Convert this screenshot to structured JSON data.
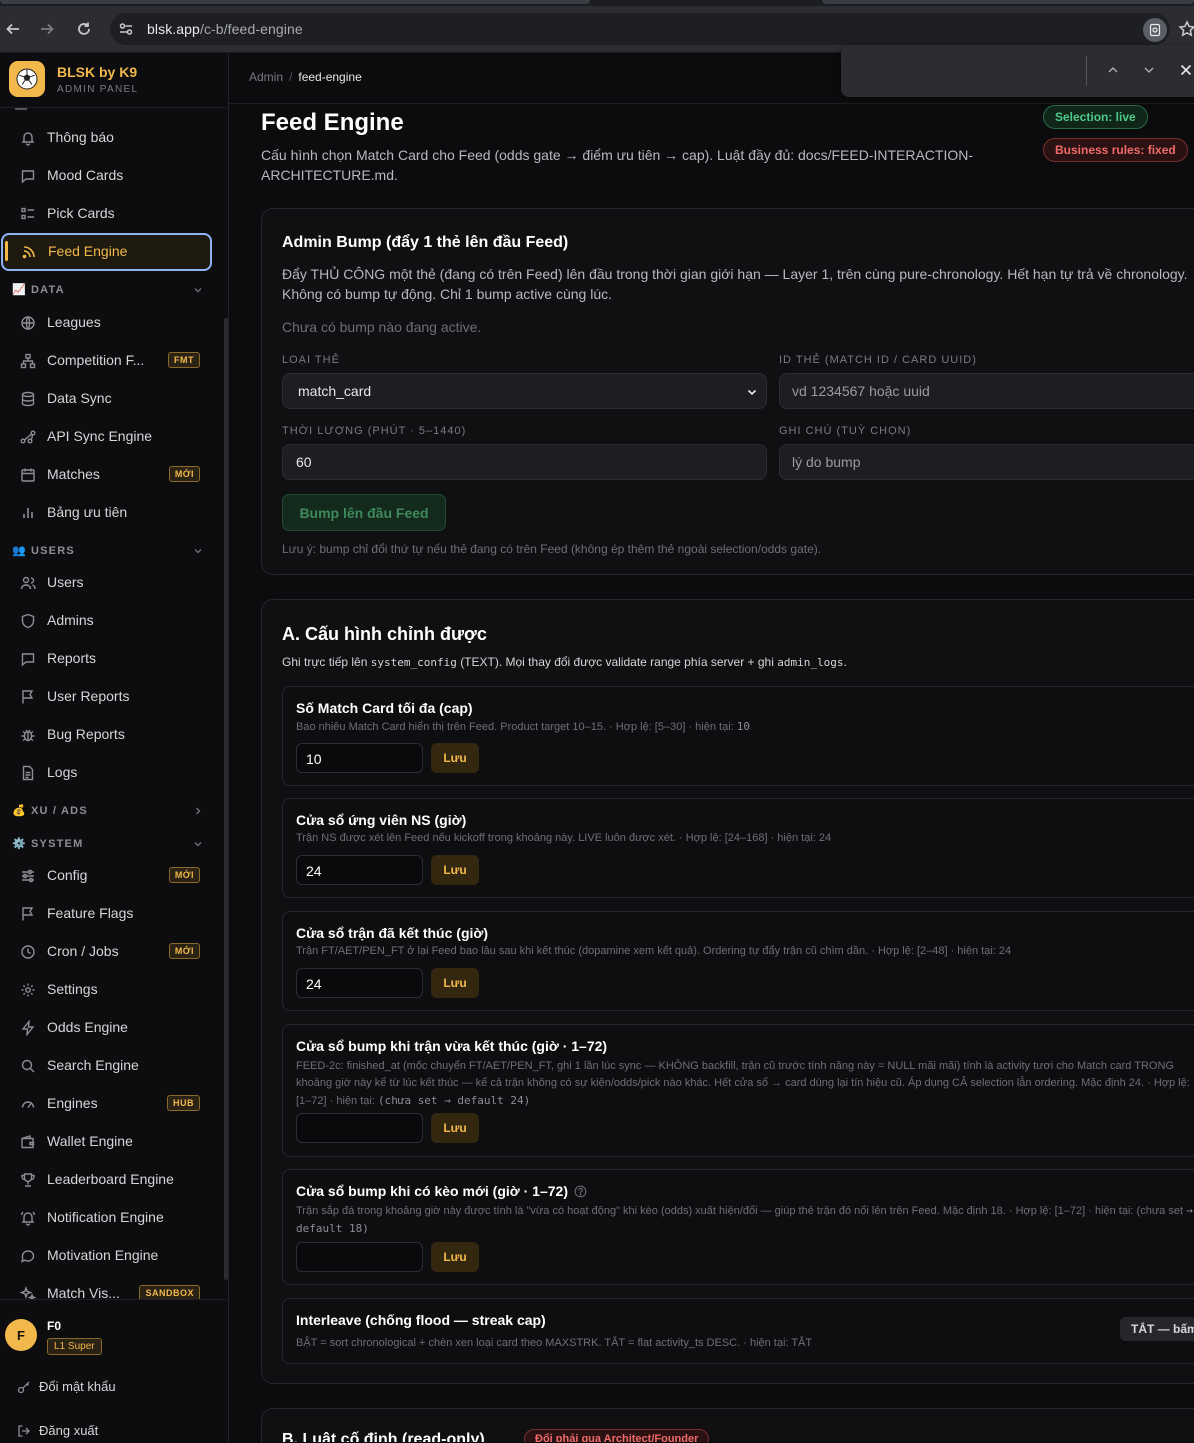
{
  "browser": {
    "url_host": "blsk.app",
    "url_path": "/c-b/feed-engine"
  },
  "brand": {
    "name": "BLSK by K9",
    "subtitle": "ADMIN PANEL"
  },
  "nav": {
    "notifications": "Thông báo",
    "mood_cards": "Mood Cards",
    "pick_cards": "Pick Cards",
    "feed_engine": "Feed Engine",
    "data_section": "DATA",
    "leagues": "Leagues",
    "competition": "Competition F...",
    "competition_badge": "FMT",
    "data_sync": "Data Sync",
    "api_sync": "API Sync Engine",
    "matches": "Matches",
    "matches_badge": "MỚI",
    "priority": "Bảng ưu tiên",
    "users_section": "USERS",
    "users": "Users",
    "admins": "Admins",
    "reports": "Reports",
    "user_reports": "User Reports",
    "bug_reports": "Bug Reports",
    "logs": "Logs",
    "xu_section": "XU / ADS",
    "system_section": "SYSTEM",
    "config": "Config",
    "config_badge": "MỚI",
    "feature_flags": "Feature Flags",
    "cron": "Cron / Jobs",
    "cron_badge": "MỚI",
    "settings": "Settings",
    "odds": "Odds Engine",
    "search": "Search Engine",
    "engines": "Engines",
    "engines_badge": "HUB",
    "wallet": "Wallet Engine",
    "leaderboard": "Leaderboard Engine",
    "notification_engine": "Notification Engine",
    "motivation": "Motivation Engine",
    "match_vis": "Match Vis...",
    "match_vis_badge": "SANDBOX"
  },
  "user": {
    "avatar": "F",
    "name": "F0",
    "role": "L1 Super",
    "change_password": "Đổi mật khẩu",
    "logout": "Đăng xuất"
  },
  "breadcrumb": {
    "root": "Admin",
    "sep": "/",
    "current": "feed-engine"
  },
  "page": {
    "title": "Feed Engine",
    "description": "Cấu hình chọn Match Card cho Feed (odds gate → điểm ưu tiên → cap). Luật đầy đủ: docs/FEED-INTERACTION-ARCHITECTURE.md.",
    "pill_live": "Selection: live",
    "pill_fixed": "Business rules: fixed"
  },
  "bump": {
    "title": "Admin Bump (đẩy 1 thẻ lên đầu Feed)",
    "description": "Đẩy THỦ CÔNG một thẻ (đang có trên Feed) lên đầu trong thời gian giới hạn — Layer 1, trên cùng pure-chronology. Hết hạn tự trả về chronology. Không có bump tự động. Chỉ 1 bump active cùng lúc.",
    "empty": "Chưa có bump nào đang active.",
    "type_label": "LOẠI THẺ",
    "type_value": "match_card",
    "id_label": "ID THẺ (MATCH ID / CARD UUID)",
    "id_placeholder": "vd 1234567 hoặc uuid",
    "duration_label": "THỜI LƯỢNG (PHÚT · 5–1440)",
    "duration_value": "60",
    "note_label": "GHI CHÚ (TUỲ CHỌN)",
    "note_placeholder": "lý do bump",
    "button": "Bump lên đầu Feed",
    "footnote": "Lưu ý: bump chỉ đổi thứ tự nếu thẻ đang có trên Feed (không ép thêm thẻ ngoài selection/odds gate)."
  },
  "config": {
    "title": "A. Cấu hình chỉnh được",
    "desc_prefix": "Ghi trực tiếp lên",
    "desc_code1": "system_config",
    "desc_mid": "(TEXT). Mọi thay đổi được validate range phía server + ghi",
    "desc_code2": "admin_logs",
    "desc_suffix": ".",
    "save": "Lưu",
    "items": [
      {
        "title": "Số Match Card tối đa (cap)",
        "desc": "Bao nhiêu Match Card hiển thị trên Feed. Product target 10–15. · Hợp lệ: [5–30] · hiện tại:",
        "current": "10",
        "value": "10"
      },
      {
        "title": "Cửa sổ ứng viên NS (giờ)",
        "desc": "Trận NS được xét lên Feed nếu kickoff trong khoảng này. LIVE luôn được xét. · Hợp lệ: [24–168] · hiện tại: 24",
        "value": "24"
      },
      {
        "title": "Cửa sổ trận đã kết thúc (giờ)",
        "desc": "Trận FT/AET/PEN_FT ở lại Feed bao lâu sau khi kết thúc (dopamine xem kết quả). Ordering tự đẩy trận cũ chìm dần. · Hợp lệ: [2–48] · hiện tại: 24",
        "value": "24"
      },
      {
        "title": "Cửa sổ bump khi trận vừa kết thúc (giờ · 1–72)",
        "desc": "FEED-2c: finished_at (mốc chuyển FT/AET/PEN_FT, ghi 1 lần lúc sync — KHÔNG backfill, trận cũ trước tính năng này = NULL mãi mãi) tính là activity tươi cho Match card TRONG khoảng giờ này kể từ lúc kết thúc — kể cả trận không có sự kiện/odds/pick nào khác. Hết cửa sổ → card dùng lại tín hiệu cũ. Áp dụng CẢ selection lẫn ordering. Mặc định 24. · Hợp lệ: [1–72] · hiện tại:",
        "current": "(chưa set → default 24)",
        "value": ""
      },
      {
        "title": "Cửa sổ bump khi có kèo mới (giờ · 1–72)",
        "desc": "Trận sắp đá trong khoảng giờ này được tính là \"vừa có hoạt động\" khi kèo (odds) xuất hiện/đổi — giúp thẻ trận đó nổi lên trên Feed. Mặc định 18. · Hợp lệ: [1–72] · hiện tại: (chưa set",
        "current": "→ default 18)",
        "value": ""
      },
      {
        "title": "Interleave (chống flood — streak cap)",
        "desc": "BẬT = sort chronological + chèn xen loại card theo MAXSTRK. TẮT = flat activity_ts DESC. · hiện tại: TẮT",
        "toggle": "TẮT — bấm để bật"
      }
    ]
  },
  "rules": {
    "title": "B. Luật cố định (read-only)",
    "pill": "Đổi phải qua Architect/Founder"
  },
  "colors": {
    "accent": "#f2b84b",
    "live": "#4fc98a",
    "danger": "#f06a6a",
    "focus": "#8fb3f5"
  }
}
